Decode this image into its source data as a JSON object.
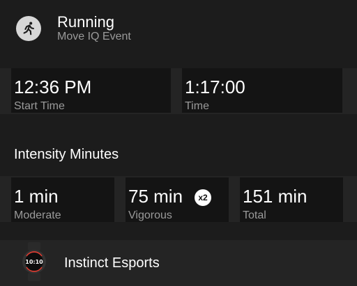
{
  "activity": {
    "title": "Running",
    "subtitle": "Move IQ Event",
    "icon": "running-person-icon"
  },
  "time_stats": [
    {
      "value": "12:36 PM",
      "label": "Start Time"
    },
    {
      "value": "1:17:00",
      "label": "Time"
    }
  ],
  "intensity": {
    "title": "Intensity Minutes",
    "stats": [
      {
        "value": "1 min",
        "label": "Moderate"
      },
      {
        "value": "75 min",
        "label": "Vigorous",
        "badge": "x2"
      },
      {
        "value": "151 min",
        "label": "Total"
      }
    ]
  },
  "device": {
    "name": "Instinct Esports",
    "screen_time": "10:10",
    "icon": "watch-icon"
  },
  "colors": {
    "background": "#1c1c1c",
    "card": "#141414",
    "secondary_text": "#9a9a9a",
    "accent_red": "#e03a2f"
  }
}
